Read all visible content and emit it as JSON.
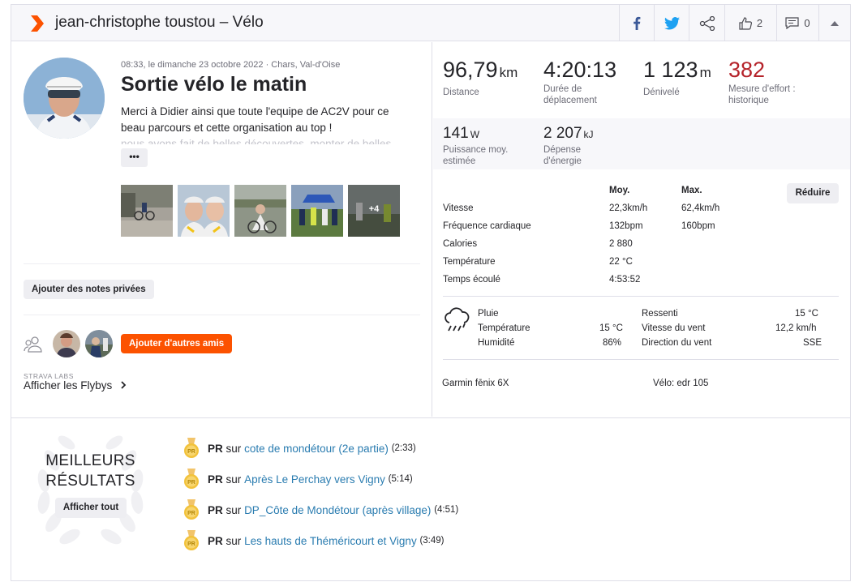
{
  "header": {
    "title": "jean-christophe toustou – Vélo",
    "kudos_count": "2",
    "comment_count": "0"
  },
  "activity": {
    "meta": "08:33, le dimanche 23 octobre 2022 · Chars, Val-d'Oise",
    "name": "Sortie vélo le matin",
    "desc_line1": "Merci à Didier ainsi que toute l'equipe de AC2V pour ce",
    "desc_line2": "beau parcours et cette organisation au top !",
    "desc_line3": "nous avons fait de belles découvertes, monter de belles",
    "more_label": "•••",
    "photo_more": "+4",
    "notes_button": "Ajouter des notes privées",
    "add_friends_button": "Ajouter d'autres amis",
    "labs_label": "STRAVA LABS",
    "flyby_link": "Afficher les Flybys"
  },
  "stats": {
    "distance": {
      "value": "96,79",
      "unit": "km",
      "label": "Distance"
    },
    "moving_time": {
      "value": "4:20:13",
      "label1": "Durée de",
      "label2": "déplacement"
    },
    "elevation": {
      "value": "1 123",
      "unit": "m",
      "label": "Dénivelé"
    },
    "effort": {
      "value": "382",
      "label1": "Mesure d'effort :",
      "label2": "historique"
    },
    "power": {
      "value": "141",
      "unit": "W",
      "label1": "Puissance moy.",
      "label2": "estimée"
    },
    "energy": {
      "value": "2 207",
      "unit": "kJ",
      "label1": "Dépense",
      "label2": "d'énergie"
    }
  },
  "details": {
    "col_avg": "Moy.",
    "col_max": "Max.",
    "reduce_button": "Réduire",
    "rows": [
      {
        "label": "Vitesse",
        "avg": "22,3km/h",
        "max": "62,4km/h"
      },
      {
        "label": "Fréquence cardiaque",
        "avg": "132bpm",
        "max": "160bpm"
      },
      {
        "label": "Calories",
        "avg": "2 880",
        "max": ""
      },
      {
        "label": "Température",
        "avg": "22 °C",
        "max": ""
      },
      {
        "label": "Temps écoulé",
        "avg": "4:53:52",
        "max": ""
      }
    ]
  },
  "weather": {
    "condition": "Pluie",
    "temp_label": "Température",
    "temp_value": "15 °C",
    "humidity_label": "Humidité",
    "humidity_value": "86%",
    "feels_label": "Ressenti",
    "feels_value": "15 °C",
    "wind_speed_label": "Vitesse du vent",
    "wind_speed_value": "12,2 km/h",
    "wind_dir_label": "Direction du vent",
    "wind_dir_value": "SSE"
  },
  "gear": {
    "device": "Garmin fēnix 6X",
    "bike": "Vélo: edr 105"
  },
  "best": {
    "title1": "MEILLEURS",
    "title2": "RÉSULTATS",
    "show_all": "Afficher tout",
    "items": [
      {
        "pr": "PR",
        "sur": "sur",
        "segment": "cote de mondétour (2e partie)",
        "time": "(2:33)"
      },
      {
        "pr": "PR",
        "sur": "sur",
        "segment": "Après Le Perchay vers Vigny",
        "time": "(5:14)"
      },
      {
        "pr": "PR",
        "sur": "sur",
        "segment": "DP_Côte de Mondétour (après village)",
        "time": "(4:51)"
      },
      {
        "pr": "PR",
        "sur": "sur",
        "segment": "Les hauts de Théméricourt et Vigny",
        "time": "(3:49)"
      }
    ]
  },
  "colors": {
    "brand": "#fc5200",
    "effort": "#b5232a",
    "link": "#2a7cb0"
  }
}
